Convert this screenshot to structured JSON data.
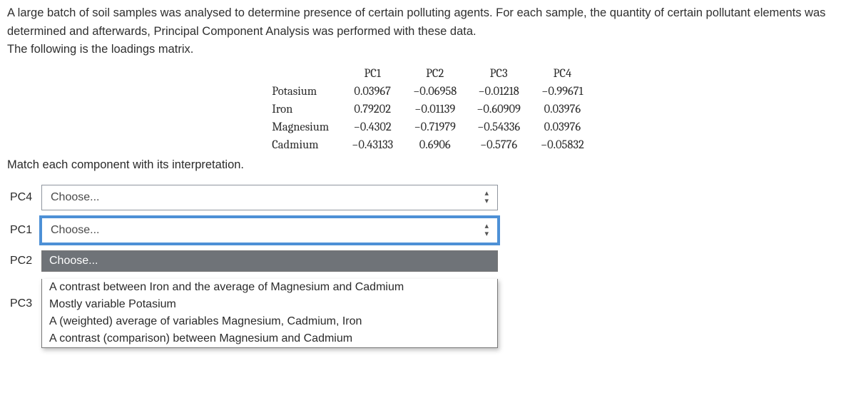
{
  "intro": {
    "p1": "A large batch of soil samples was analysed to determine presence of certain polluting agents. For each sample, the quantity of certain pollutant elements was determined and afterwards, Principal Component Analysis was performed with these data.",
    "p2": "The following is the loadings matrix."
  },
  "table": {
    "cols": [
      "PC1",
      "PC2",
      "PC3",
      "PC4"
    ],
    "rows": [
      {
        "name": "Potasium",
        "v": [
          "0.03967",
          "−0.06958",
          "−0.01218",
          "−0.99671"
        ]
      },
      {
        "name": "Iron",
        "v": [
          "0.79202",
          "−0.01139",
          "−0.60909",
          "0.03976"
        ]
      },
      {
        "name": "Magnesium",
        "v": [
          "−0.4302",
          "−0.71979",
          "−0.54336",
          "0.03976"
        ]
      },
      {
        "name": "Cadmium",
        "v": [
          "−0.43133",
          "0.6906",
          "−0.5776",
          "−0.05832"
        ]
      }
    ]
  },
  "matchPrompt": "Match each component with its interpretation.",
  "matches": {
    "labels": {
      "pc4": "PC4",
      "pc1": "PC1",
      "pc2": "PC2",
      "pc3": "PC3"
    },
    "placeholder": "Choose...",
    "options": [
      "Choose...",
      "A contrast between Iron and the average of Magnesium and Cadmium",
      "Mostly variable Potasium",
      "A (weighted) average of variables Magnesium, Cadmium, Iron",
      "A contrast (comparison) between Magnesium and Cadmium"
    ]
  }
}
